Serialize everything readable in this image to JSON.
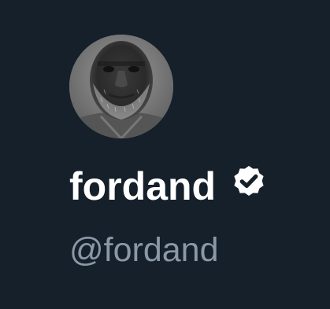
{
  "profile": {
    "display_name": "fordand",
    "handle": "@fordand",
    "verified": true,
    "avatar_icon": "profile-photo",
    "badge_icon": "verified-badge-icon"
  },
  "colors": {
    "background": "#15202b",
    "name": "#ffffff",
    "handle": "#8b98a5",
    "badge": "#ffffff"
  }
}
